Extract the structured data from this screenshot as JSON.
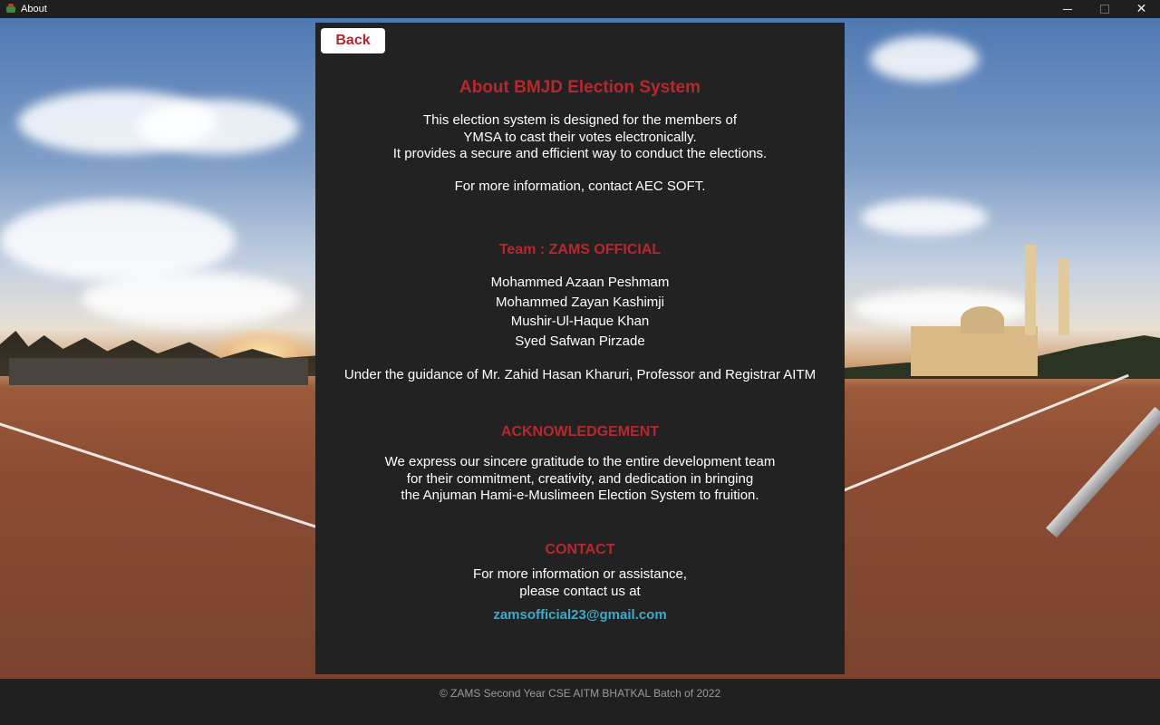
{
  "window": {
    "title": "About"
  },
  "back_label": "Back",
  "about": {
    "heading": "About BMJD Election System",
    "lines": [
      "This election system is designed for the members of",
      "YMSA to cast their votes electronically.",
      "It provides a secure and efficient way to conduct the elections."
    ],
    "contact_line": "For more information, contact AEC SOFT."
  },
  "team": {
    "heading": "Team : ZAMS OFFICIAL",
    "members": [
      "Mohammed Azaan Peshmam",
      "Mohammed Zayan Kashimji",
      "Mushir-Ul-Haque Khan",
      "Syed Safwan Pirzade"
    ],
    "guidance": "Under the guidance of Mr. Zahid Hasan Kharuri, Professor and Registrar AITM"
  },
  "acknowledgement": {
    "heading": "ACKNOWLEDGEMENT",
    "lines": [
      "We express our sincere gratitude to the entire development team",
      "for their commitment, creativity, and dedication in bringing",
      "the Anjuman Hami-e-Muslimeen Election System to fruition."
    ]
  },
  "contact": {
    "heading": "CONTACT",
    "lines": [
      "For more information or assistance,",
      "please contact us at"
    ],
    "email": "zamsofficial23@gmail.com"
  },
  "footer": {
    "copyright": "© ZAMS Second Year CSE AITM BHATKAL Batch of 2022"
  },
  "colors": {
    "accent_red": "#b7282e",
    "email_blue": "#3fa9c6",
    "panel_bg": "#222222"
  }
}
